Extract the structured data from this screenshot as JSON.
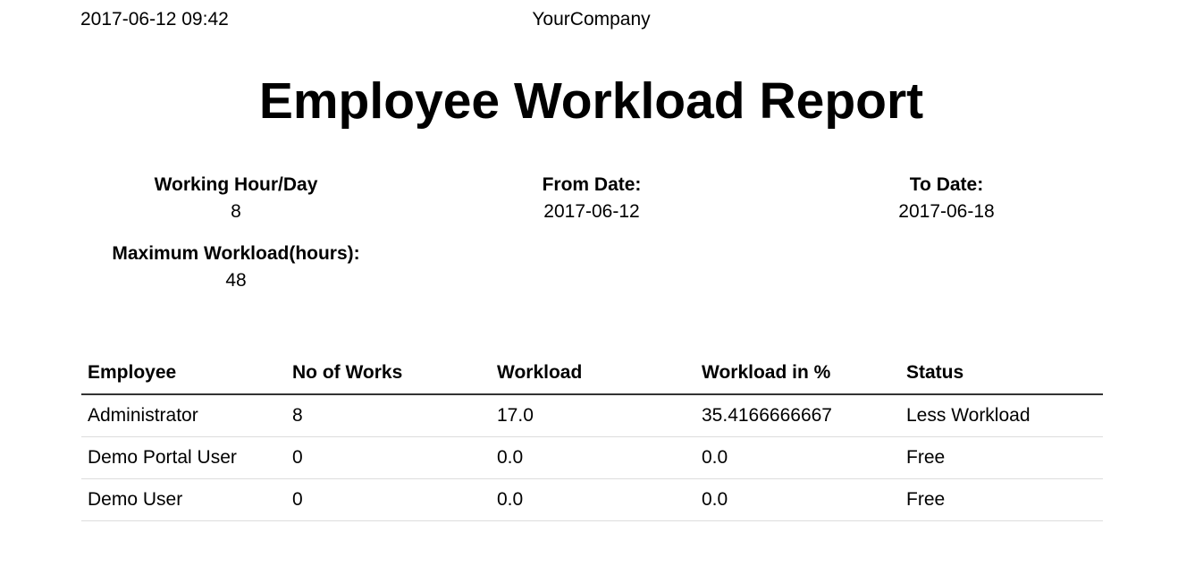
{
  "header": {
    "datetime": "2017-06-12 09:42",
    "company": "YourCompany"
  },
  "report": {
    "title": "Employee Workload Report",
    "working_hour": {
      "label": "Working Hour/Day",
      "value": "8"
    },
    "from_date": {
      "label": "From Date:",
      "value": "2017-06-12"
    },
    "to_date": {
      "label": "To Date:",
      "value": "2017-06-18"
    },
    "max_workload": {
      "label": "Maximum Workload(hours):",
      "value": "48"
    }
  },
  "table": {
    "columns": [
      "Employee",
      "No of Works",
      "Workload",
      "Workload in %",
      "Status"
    ],
    "rows": [
      [
        "Administrator",
        "8",
        "17.0",
        "35.4166666667",
        "Less Workload"
      ],
      [
        "Demo Portal User",
        "0",
        "0.0",
        "0.0",
        "Free"
      ],
      [
        "Demo User",
        "0",
        "0.0",
        "0.0",
        "Free"
      ]
    ]
  }
}
